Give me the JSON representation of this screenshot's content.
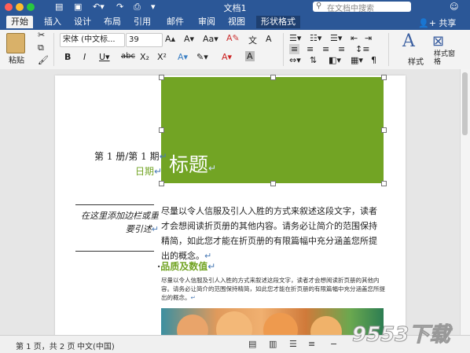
{
  "window": {
    "title": "文档1"
  },
  "search": {
    "placeholder": "在文档中搜索"
  },
  "tabs": [
    "开始",
    "插入",
    "设计",
    "布局",
    "引用",
    "邮件",
    "审阅",
    "视图",
    "形状格式"
  ],
  "share_label": "共享",
  "ribbon": {
    "paste_label": "粘贴",
    "font_name": "宋体 (中文标...",
    "font_size": "39",
    "styles_label": "样式",
    "styles_pane_label": "样式窗格"
  },
  "document": {
    "heading": "标题",
    "pagenum": "第 1 册/第 1 期",
    "date": "日期",
    "sidebar_quote": "在这里添加边栏或重要引述",
    "body": "尽量以令人信服及引人入胜的方式来叙述这段文字，读者才会想阅读折页册的其他内容。请务必让简介的范围保持精简，如此您才能在折页册的有限篇幅中充分涵盖您所提出的概念。",
    "subheading": "品质及数值",
    "small_body": "尽量以令人信服及引人入胜的方式来叙述这段文字，读者才会想阅读折页册的其他内容。请务必让简介的范围保持精简，如此您才能在折页册的有限篇幅中充分涵盖您所提出的概念。"
  },
  "status": {
    "pages": "第 1 页，共 2 页",
    "language": "中文(中国)"
  },
  "watermark": "9553下载",
  "colors": {
    "accent": "#2b5797",
    "green": "#72a424",
    "heading_green": "#72a424"
  }
}
